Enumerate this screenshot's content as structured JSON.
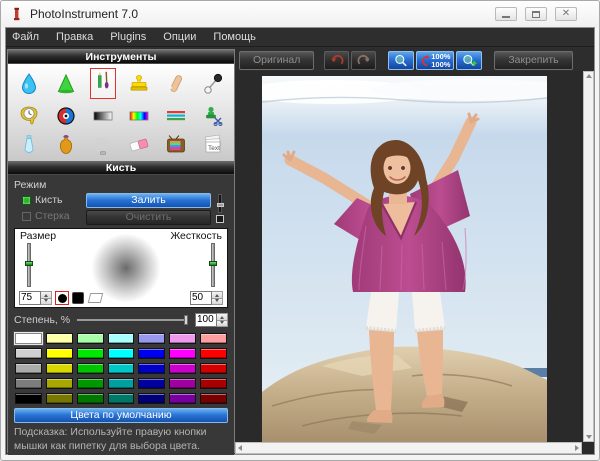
{
  "window": {
    "title": "PhotoInstrument 7.0"
  },
  "menu": {
    "items": [
      "Файл",
      "Правка",
      "Plugins",
      "Опции",
      "Помощь"
    ]
  },
  "tools_panel": {
    "title": "Инструменты",
    "tools": [
      "water-drop",
      "cone",
      "pencil-brush-selected",
      "stamp",
      "finger",
      "pin",
      "melted-clock",
      "red-eye",
      "bw-gradient",
      "rainbow-gradient",
      "color-lines",
      "stamp-scissors",
      "tube",
      "bottle",
      "spiral-bulb",
      "eraser",
      "tv-noise",
      "text-stack"
    ]
  },
  "brush_panel": {
    "title": "Кисть",
    "mode_label": "Режим",
    "brush_label": "Кисть",
    "eraser_label": "Стерка",
    "fill_button": "Залить",
    "clear_button": "Очистить",
    "size_label": "Размер",
    "hardness_label": "Жесткость",
    "size_value": "75",
    "hardness_value": "50",
    "opacity_label": "Степень, %",
    "opacity_value": "100",
    "default_colors_button": "Цвета по умолчанию",
    "hint": "Подсказка: Используйте правую кнопки мышки как пипетку для выбора цвета.",
    "palette": [
      [
        "#ffffff",
        "#ffffa8",
        "#a8ffa8",
        "#a8ffff",
        "#9898ee",
        "#ee98ee",
        "#ff9e9e"
      ],
      [
        "#cfcfcf",
        "#ffff00",
        "#00e800",
        "#00ffff",
        "#0000f0",
        "#ff00ff",
        "#ff0000"
      ],
      [
        "#ababab",
        "#d8d800",
        "#00c400",
        "#00c8c8",
        "#0000c8",
        "#cc00cc",
        "#d40000"
      ],
      [
        "#7d7d7d",
        "#a8a800",
        "#009800",
        "#00a0a0",
        "#0000a0",
        "#a000a0",
        "#a80000"
      ],
      [
        "#000000",
        "#787800",
        "#007800",
        "#007868",
        "#000078",
        "#7800a0",
        "#780000"
      ]
    ]
  },
  "toolbar": {
    "original_button": "Оригинал",
    "zoom_value_top": "100%",
    "zoom_value_bottom": "100%",
    "pin_button": "Закрепить"
  },
  "colors": {
    "accent_blue": "#2a74d8",
    "selection_red": "#e03030",
    "panel_dark": "#383838",
    "canvas_dark": "#2a2a2a"
  }
}
